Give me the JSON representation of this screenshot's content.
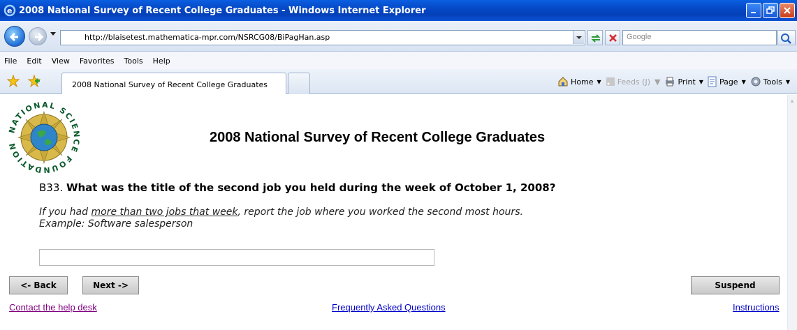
{
  "window": {
    "title": "2008 National Survey of Recent College Graduates - Windows Internet Explorer"
  },
  "address_bar": {
    "url": "http://blaisetest.mathematica-mpr.com/NSRCG08/BiPagHan.asp",
    "search_placeholder": "Google"
  },
  "menu": {
    "items": [
      "File",
      "Edit",
      "View",
      "Favorites",
      "Tools",
      "Help"
    ]
  },
  "tabs": {
    "active_label": "2008 National Survey of Recent College Graduates"
  },
  "command_bar": {
    "home": "Home",
    "feeds": "Feeds (J)",
    "print": "Print",
    "page": "Page",
    "tools": "Tools"
  },
  "page": {
    "logo_text": "NATIONAL SCIENCE FOUNDATION",
    "title": "2008 National Survey of Recent College Graduates",
    "question_number": "B33.",
    "question_text": "What was the title of the second job you held during the week of October 1, 2008?",
    "instruction_prefix": "If you had ",
    "instruction_underlined": "more than two jobs that week",
    "instruction_suffix": ", report the job where you worked the second most hours.",
    "example": "Example: Software salesperson",
    "answer_value": "",
    "buttons": {
      "back": "<- Back",
      "next": "Next ->",
      "suspend": "Suspend"
    },
    "links": {
      "help_desk": "Contact the help desk",
      "faq": "Frequently Asked Questions",
      "instructions": "Instructions"
    }
  },
  "colors": {
    "titlebar": "#0546c4",
    "visited_link": "#800080",
    "link": "#0000cc"
  },
  "icons": [
    "ie-icon",
    "minimize-icon",
    "maximize-icon",
    "close-icon",
    "back-icon",
    "forward-icon",
    "refresh-icon",
    "stop-icon",
    "search-icon",
    "favorites-star-icon",
    "add-favorites-icon",
    "home-icon",
    "feeds-icon",
    "print-icon",
    "page-icon",
    "tools-icon"
  ]
}
